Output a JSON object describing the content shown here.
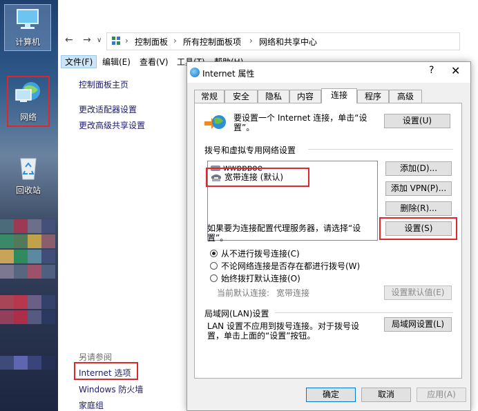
{
  "desktop": {
    "icons": [
      {
        "label": "计算机",
        "icon": "computer-icon"
      },
      {
        "label": "网络",
        "icon": "network-icon"
      },
      {
        "label": "回收站",
        "icon": "recycle-bin-icon"
      }
    ]
  },
  "explorer": {
    "breadcrumbs": [
      "控制面板",
      "所有控制面板项",
      "网络和共享中心"
    ],
    "menus": [
      "文件(F)",
      "编辑(E)",
      "查看(V)",
      "工具(T)",
      "帮助(H)"
    ],
    "left_nav": {
      "home": "控制面板主页",
      "adapter": "更改适配器设置",
      "advanced": "更改高级共享设置",
      "see_also": "另请参阅",
      "internet_options": "Internet 选项",
      "firewall": "Windows 防火墙",
      "homegroup": "家庭组"
    }
  },
  "dialog": {
    "title": "Internet 属性",
    "help": "?",
    "close": "✕",
    "tabs": [
      "常规",
      "安全",
      "隐私",
      "内容",
      "连接",
      "程序",
      "高级"
    ],
    "active_tab": "连接",
    "setup_text": "要设置一个 Internet 连接，单击“设置”。",
    "setup_button": "设置(U)",
    "dialup_group": "拨号和虚拟专用网络设置",
    "connections": [
      {
        "name": "wwpppoe"
      },
      {
        "name": "宽带连接 (默认)"
      }
    ],
    "add_button": "添加(D)...",
    "add_vpn_button": "添加 VPN(P)...",
    "remove_button": "删除(R)...",
    "proxy_text": "如果要为连接配置代理服务器，请选择“设置”。",
    "settings_button": "设置(S)",
    "radio_options": [
      {
        "label": "从不进行拨号连接(C)",
        "checked": true
      },
      {
        "label": "不论网络连接是否存在都进行拨号(W)",
        "checked": false
      },
      {
        "label": "始终拨打默认连接(O)",
        "checked": false
      }
    ],
    "current_default_label": "当前默认连接:",
    "current_default_value": "宽带连接",
    "set_default_button": "设置默认值(E)",
    "lan_group": "局域网(LAN)设置",
    "lan_text": "LAN 设置不应用到拨号连接。对于拨号设置，单击上面的“设置”按钮。",
    "lan_button": "局域网设置(L)",
    "ok_button": "确定",
    "cancel_button": "取消",
    "apply_button": "应用(A)"
  },
  "colors": {
    "highlight_box": "#e0262b",
    "link": "#1a1a6e",
    "focus_border": "#0078d7"
  }
}
